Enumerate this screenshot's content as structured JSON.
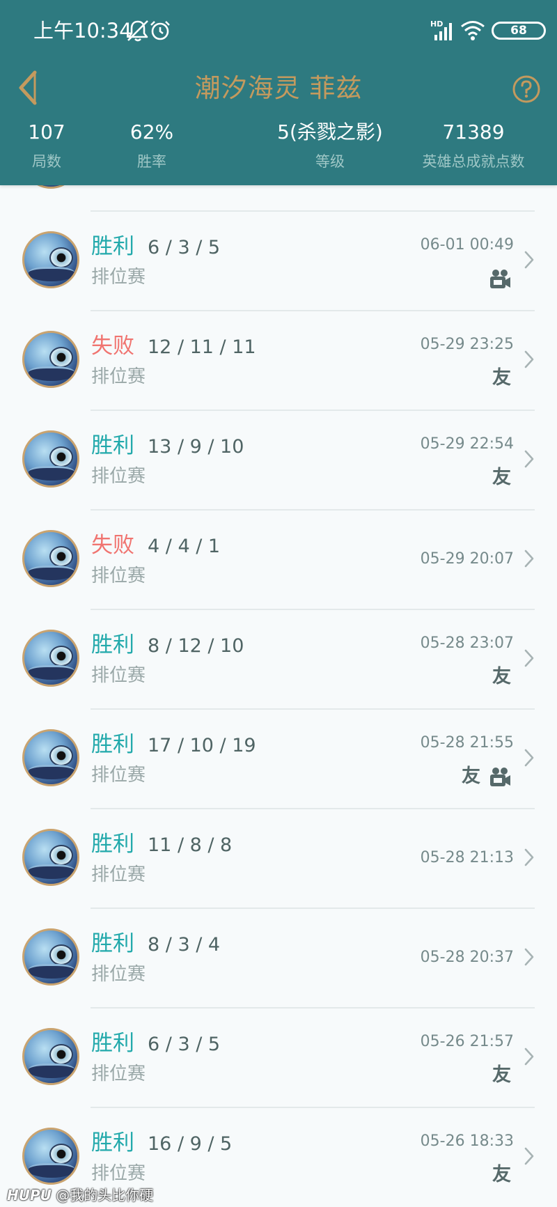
{
  "status_bar": {
    "time": "上午10:34",
    "battery": "68",
    "icons": [
      "bell-muted-icon",
      "alarm-icon",
      "hd-signal-icon",
      "wifi-icon",
      "battery-icon"
    ]
  },
  "header": {
    "title": "潮汐海灵 菲兹",
    "back_icon": "chevron-left-icon",
    "help_icon": "question-circle-icon",
    "title_color": "#c49a5e",
    "background_color": "#2e7a80"
  },
  "stats": [
    {
      "value": "107",
      "label": "局数"
    },
    {
      "value": "62%",
      "label": "胜率"
    },
    {
      "value": "5(杀戮之影)",
      "label": "等级"
    },
    {
      "value": "71389",
      "label": "英雄总成就点数"
    }
  ],
  "colors": {
    "win": "#22a9ab",
    "loss": "#f07470"
  },
  "matches": [
    {
      "result": "胜利",
      "kda": "6 / 3 / 5",
      "mode": "排位赛",
      "time": "06-01 00:49",
      "badges": [
        "video-icon"
      ]
    },
    {
      "result": "失败",
      "kda": "12 / 11 / 11",
      "mode": "排位赛",
      "time": "05-29 23:25",
      "badges": [
        "友"
      ]
    },
    {
      "result": "胜利",
      "kda": "13 / 9 / 10",
      "mode": "排位赛",
      "time": "05-29 22:54",
      "badges": [
        "友"
      ]
    },
    {
      "result": "失败",
      "kda": "4 / 4 / 1",
      "mode": "排位赛",
      "time": "05-29 20:07",
      "badges": []
    },
    {
      "result": "胜利",
      "kda": "8 / 12 / 10",
      "mode": "排位赛",
      "time": "05-28 23:07",
      "badges": [
        "友"
      ]
    },
    {
      "result": "胜利",
      "kda": "17 / 10 / 19",
      "mode": "排位赛",
      "time": "05-28 21:55",
      "badges": [
        "友",
        "video-icon"
      ]
    },
    {
      "result": "胜利",
      "kda": "11 / 8 / 8",
      "mode": "排位赛",
      "time": "05-28 21:13",
      "badges": []
    },
    {
      "result": "胜利",
      "kda": "8 / 3 / 4",
      "mode": "排位赛",
      "time": "05-28 20:37",
      "badges": []
    },
    {
      "result": "胜利",
      "kda": "6 / 3 / 5",
      "mode": "排位赛",
      "time": "05-26 21:57",
      "badges": [
        "友"
      ]
    },
    {
      "result": "胜利",
      "kda": "16 / 9 / 5",
      "mode": "排位赛",
      "time": "05-26 18:33",
      "badges": [
        "友"
      ]
    }
  ],
  "watermark": {
    "brand": "HUPU",
    "user": "@我的头比你硬"
  }
}
